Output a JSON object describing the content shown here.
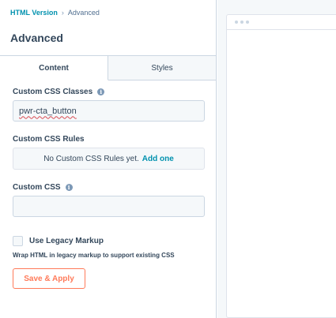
{
  "breadcrumb": {
    "parent": "HTML Version",
    "separator": "›",
    "current": "Advanced"
  },
  "panel": {
    "title": "Advanced"
  },
  "tabs": [
    {
      "label": "Content",
      "active": true
    },
    {
      "label": "Styles",
      "active": false
    }
  ],
  "custom_css_classes": {
    "label": "Custom CSS Classes",
    "value": "pwr-cta_button"
  },
  "custom_css_rules": {
    "label": "Custom CSS Rules",
    "empty_text": "No Custom CSS Rules yet.",
    "add_link": "Add one"
  },
  "custom_css": {
    "label": "Custom CSS",
    "value": ""
  },
  "legacy_markup": {
    "label": "Use Legacy Markup",
    "checked": false,
    "help": "Wrap HTML in legacy markup to support existing CSS"
  },
  "actions": {
    "save_label": "Save & Apply"
  },
  "colors": {
    "accent_link": "#0091ae",
    "primary_button": "#ff7a59",
    "text": "#33475b",
    "border": "#cbd6e2"
  }
}
